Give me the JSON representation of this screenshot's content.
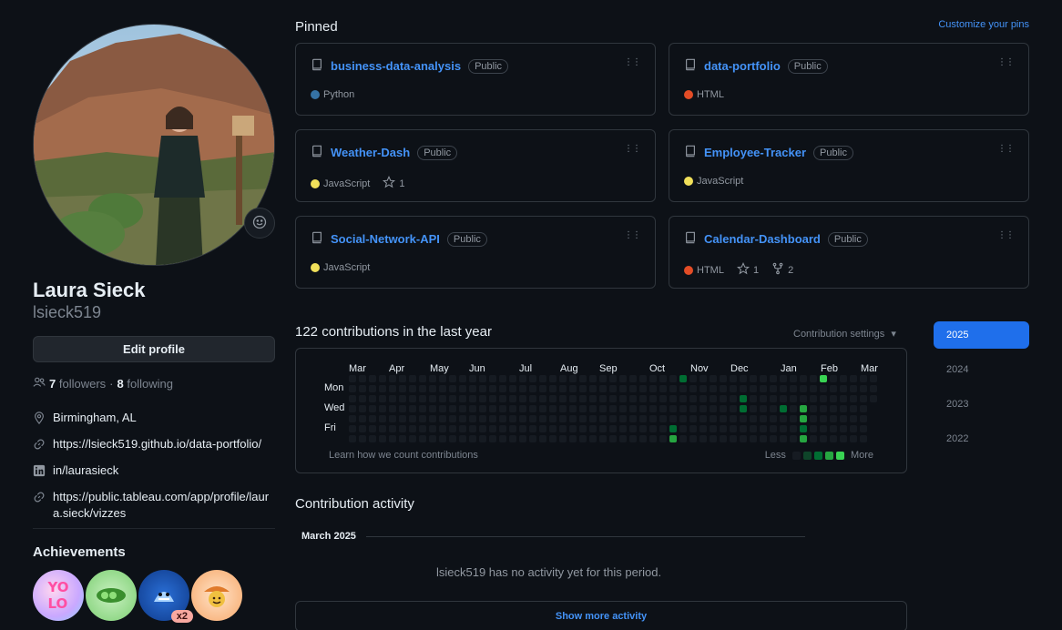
{
  "profile": {
    "name": "Laura Sieck",
    "login": "lsieck519",
    "edit_label": "Edit profile",
    "followers_count": "7",
    "followers_label": "followers",
    "following_count": "8",
    "following_label": "following",
    "location": "Birmingham, AL",
    "website": "https://lsieck519.github.io/data-portfolio/",
    "linkedin": "in/laurasieck",
    "tableau": "https://public.tableau.com/app/profile/laur a.sieck/vizzes"
  },
  "achievements": {
    "title": "Achievements",
    "badges": [
      {
        "name": "YOLO",
        "count": ""
      },
      {
        "name": "Pair Extraordinaire",
        "count": ""
      },
      {
        "name": "Pull Shark",
        "count": "x2"
      },
      {
        "name": "Quickdraw",
        "count": ""
      }
    ]
  },
  "pinned": {
    "title": "Pinned",
    "customize_label": "Customize your pins",
    "repos": [
      {
        "name": "business-data-analysis",
        "visibility": "Public",
        "language": "Python",
        "lang_color": "#3572A5",
        "stars": "",
        "forks": ""
      },
      {
        "name": "data-portfolio",
        "visibility": "Public",
        "language": "HTML",
        "lang_color": "#e34c26",
        "stars": "",
        "forks": ""
      },
      {
        "name": "Weather-Dash",
        "visibility": "Public",
        "language": "JavaScript",
        "lang_color": "#f1e05a",
        "stars": "1",
        "forks": ""
      },
      {
        "name": "Employee-Tracker",
        "visibility": "Public",
        "language": "JavaScript",
        "lang_color": "#f1e05a",
        "stars": "",
        "forks": ""
      },
      {
        "name": "Social-Network-API",
        "visibility": "Public",
        "language": "JavaScript",
        "lang_color": "#f1e05a",
        "stars": "",
        "forks": ""
      },
      {
        "name": "Calendar-Dashboard",
        "visibility": "Public",
        "language": "HTML",
        "lang_color": "#e34c26",
        "stars": "1",
        "forks": "2"
      }
    ]
  },
  "contributions": {
    "title": "122 contributions in the last year",
    "settings_label": "Contribution settings",
    "months": [
      "Mar",
      "Apr",
      "May",
      "Jun",
      "Jul",
      "Aug",
      "Sep",
      "Oct",
      "Nov",
      "Dec",
      "Jan",
      "Feb",
      "Mar"
    ],
    "days": [
      "Mon",
      "Wed",
      "Fri"
    ],
    "learn_label": "Learn how we count contributions",
    "legend_less": "Less",
    "legend_more": "More",
    "level_colors": [
      "#161b22",
      "#0e4429",
      "#006d32",
      "#26a641",
      "#39d353"
    ],
    "active_cells": [
      {
        "week": 32,
        "day": 6,
        "level": 3
      },
      {
        "week": 32,
        "day": 7,
        "level": 2
      },
      {
        "week": 32,
        "day": 5,
        "level": 2
      },
      {
        "week": 33,
        "day": 0,
        "level": 2
      },
      {
        "week": 39,
        "day": 2,
        "level": 2
      },
      {
        "week": 39,
        "day": 3,
        "level": 2
      },
      {
        "week": 43,
        "day": 3,
        "level": 2
      },
      {
        "week": 45,
        "day": 3,
        "level": 3
      },
      {
        "week": 45,
        "day": 4,
        "level": 3
      },
      {
        "week": 45,
        "day": 5,
        "level": 2
      },
      {
        "week": 45,
        "day": 6,
        "level": 3
      },
      {
        "week": 46,
        "day": 7,
        "level": 1
      },
      {
        "week": 47,
        "day": 0,
        "level": 4
      }
    ]
  },
  "years": [
    "2025",
    "2024",
    "2023",
    "2022"
  ],
  "active_year": "2025",
  "activity": {
    "title": "Contribution activity",
    "month": "March 2025",
    "empty": "lsieck519 has no activity yet for this period.",
    "show_more": "Show more activity"
  }
}
